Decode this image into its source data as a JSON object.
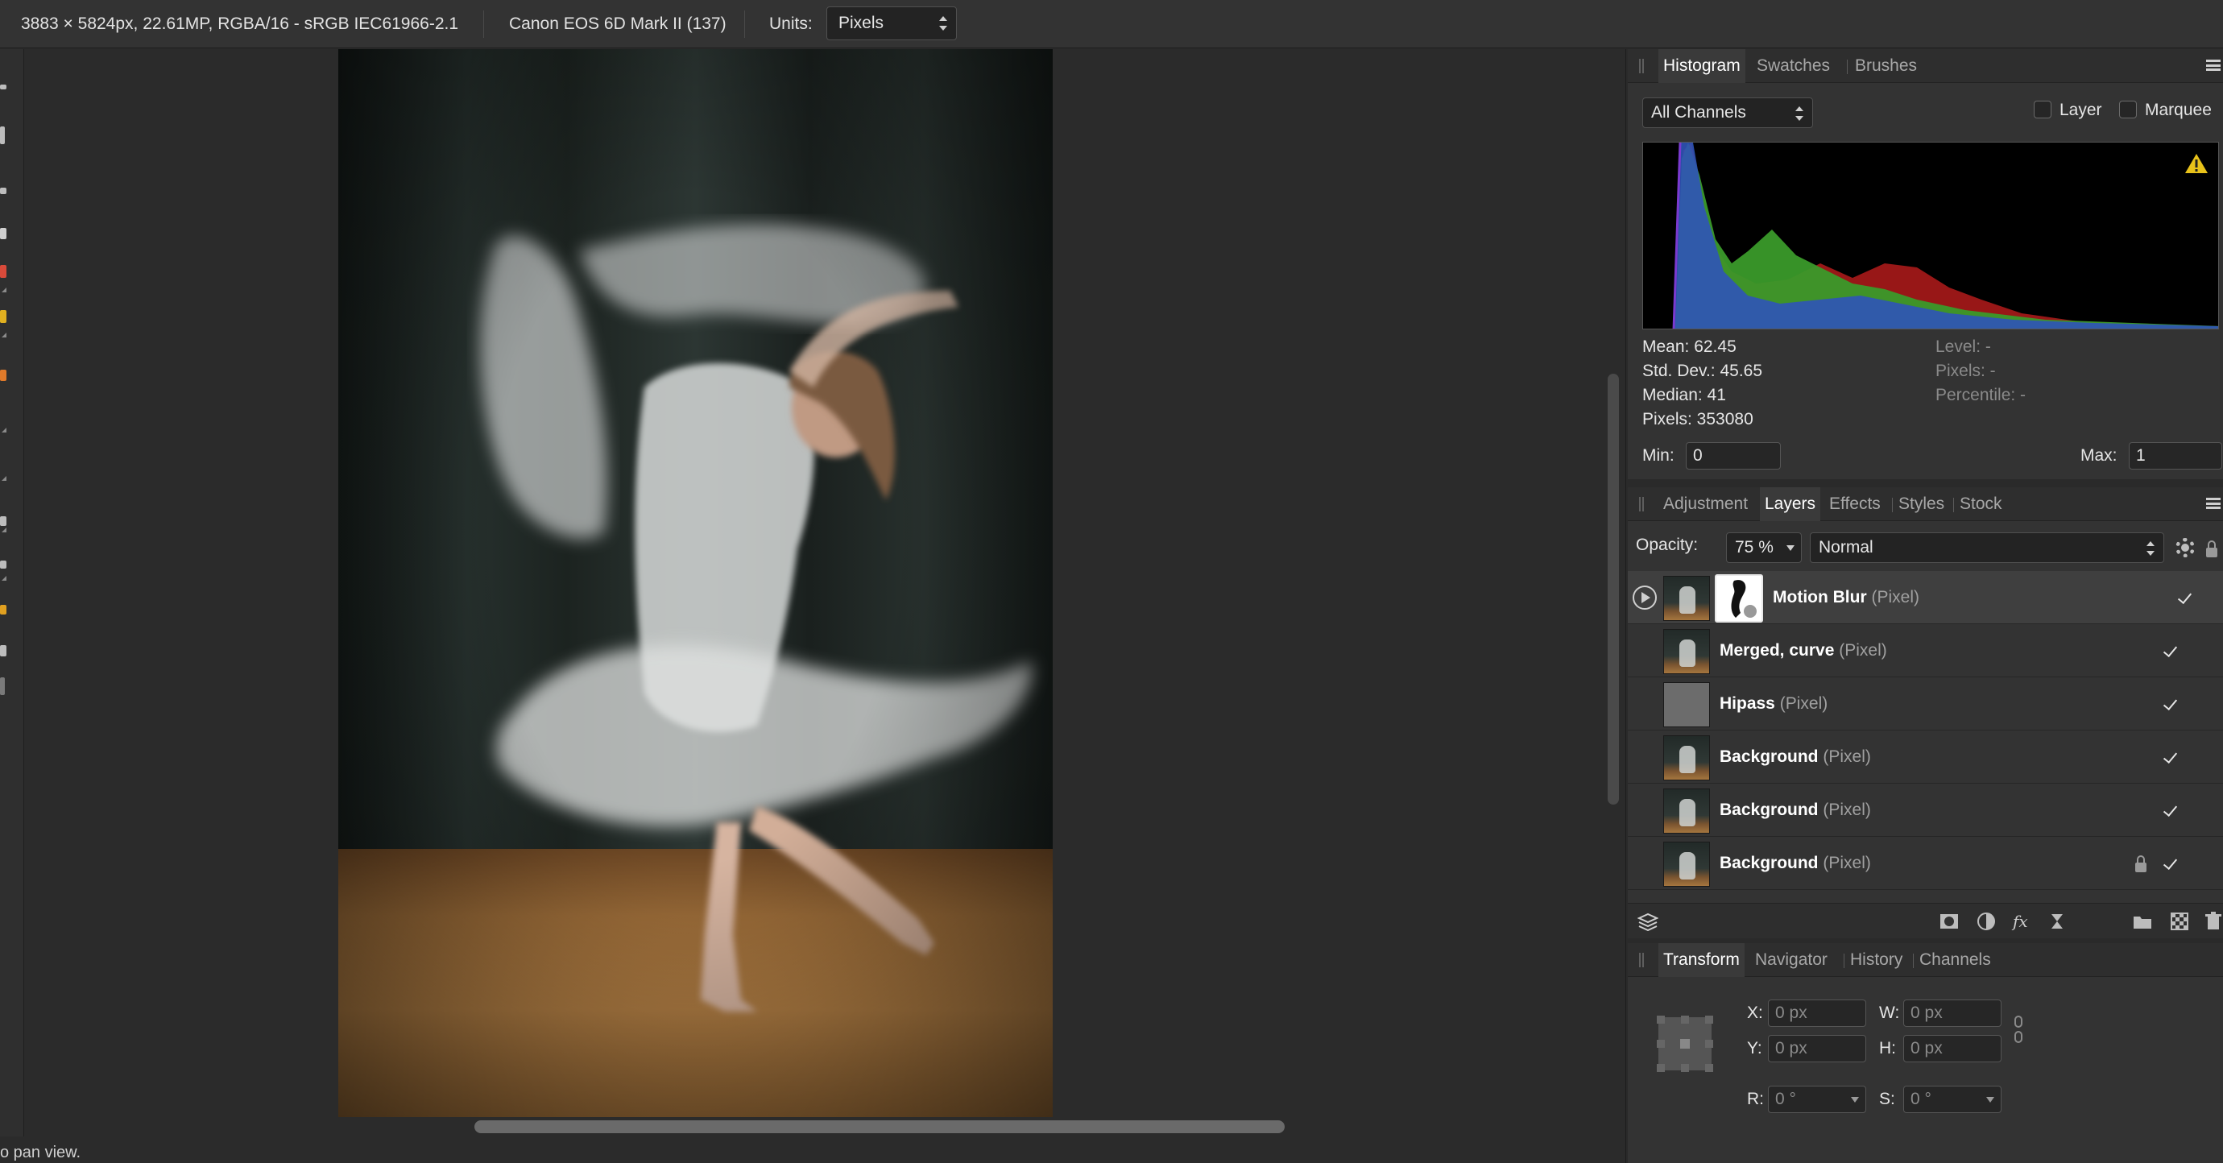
{
  "topbar": {
    "image_info": "3883 × 5824px, 22.61MP, RGBA/16 - sRGB IEC61966-2.1",
    "camera": "Canon EOS 6D Mark II (137)",
    "units_label": "Units:",
    "units_value": "Pixels"
  },
  "status_hint": "o pan view.",
  "histogram_panel": {
    "tabs": [
      "Histogram",
      "Swatches",
      "Brushes"
    ],
    "active_tab": "Histogram",
    "channel_select": "All Channels",
    "layer_checkbox_label": "Layer",
    "marquee_checkbox_label": "Marquee",
    "stats_left": [
      "Mean: 62.45",
      "Std. Dev.: 45.65",
      "Median: 41",
      "Pixels: 353080"
    ],
    "stats_right": [
      "Level: -",
      "Pixels: -",
      "Percentile: -"
    ],
    "min_label": "Min:",
    "min_value": "0",
    "max_label": "Max:",
    "max_value": "1",
    "colors": {
      "blue": "#2f54b8",
      "green": "#3a9a2a",
      "red": "#a01818"
    }
  },
  "layers_panel": {
    "tabs": [
      "Adjustment",
      "Layers",
      "Effects",
      "Styles",
      "Stock"
    ],
    "active_tab": "Layers",
    "opacity_label": "Opacity:",
    "opacity_value": "75 %",
    "blend_mode": "Normal",
    "layers": [
      {
        "name": "Motion Blur",
        "type": "(Pixel)",
        "visible": true,
        "selected": true,
        "has_mask": true,
        "locked": false
      },
      {
        "name": "Merged, curve",
        "type": "(Pixel)",
        "visible": true,
        "selected": false,
        "has_mask": false,
        "locked": false
      },
      {
        "name": "Hipass",
        "type": "(Pixel)",
        "visible": true,
        "selected": false,
        "has_mask": false,
        "locked": false
      },
      {
        "name": "Background",
        "type": "(Pixel)",
        "visible": true,
        "selected": false,
        "has_mask": false,
        "locked": false
      },
      {
        "name": "Background",
        "type": "(Pixel)",
        "visible": true,
        "selected": false,
        "has_mask": false,
        "locked": false
      },
      {
        "name": "Background",
        "type": "(Pixel)",
        "visible": true,
        "selected": false,
        "has_mask": false,
        "locked": true
      }
    ],
    "bottom_icons": [
      "layers-stack-icon",
      "mask-icon",
      "adjustment-icon",
      "fx-icon",
      "live-filter-icon",
      "folder-icon",
      "checkerboard-icon",
      "trash-icon"
    ]
  },
  "transform_panel": {
    "tabs": [
      "Transform",
      "Navigator",
      "History",
      "Channels"
    ],
    "active_tab": "Transform",
    "x_label": "X:",
    "x_value": "0 px",
    "y_label": "Y:",
    "y_value": "0 px",
    "w_label": "W:",
    "w_value": "0 px",
    "h_label": "H:",
    "h_value": "0 px",
    "r_label": "R:",
    "r_value": "0 °",
    "s_label": "S:",
    "s_value": "0 °"
  }
}
